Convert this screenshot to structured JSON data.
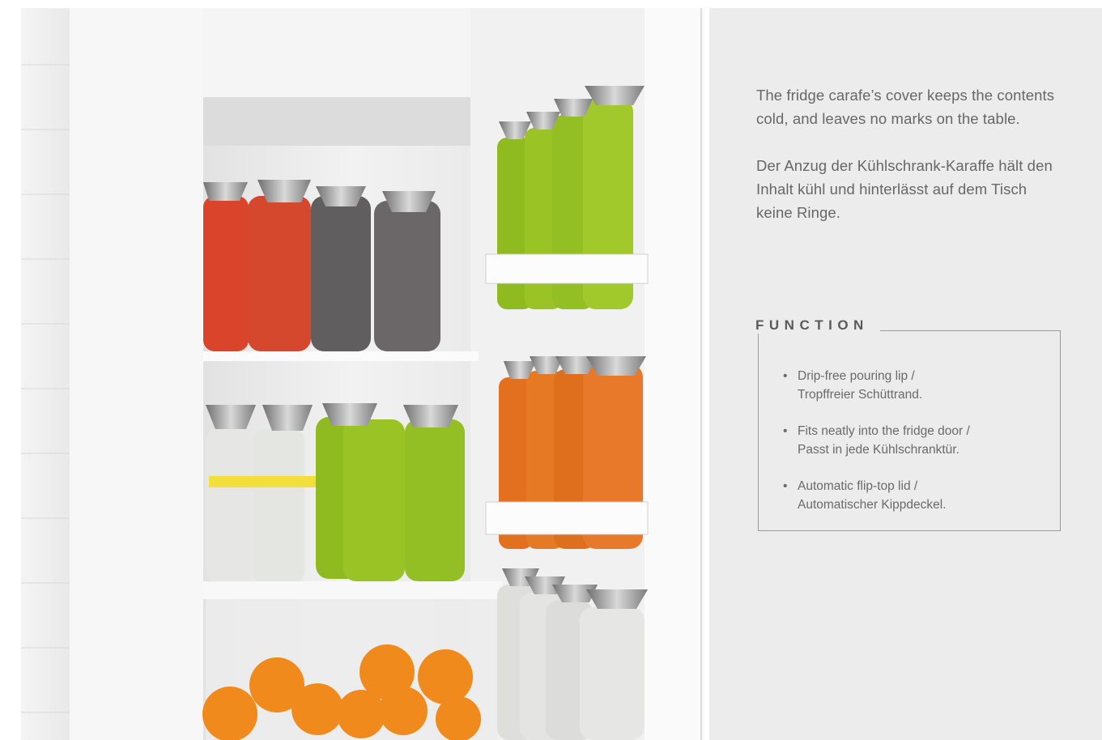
{
  "intro": {
    "english": "The fridge carafe’s cover keeps the contents cold, and leaves no marks on the table.",
    "german": "Der Anzug der Kühlschrank-Karaffe hält den Inhalt kühl und hinterlässt auf dem Tisch keine Ringe."
  },
  "function": {
    "title": "FUNCTION",
    "bullet": "•",
    "items": [
      {
        "line1": "Drip-free pouring lip /",
        "line2": "Tropffreier Schüttrand."
      },
      {
        "line1": "Fits neatly into the fridge door /",
        "line2": "Passt in jede Kühlschranktür."
      },
      {
        "line1": "Automatic flip-top lid /",
        "line2": "Automatischer Kippdeckel."
      }
    ]
  },
  "colors": {
    "panel_bg": "#ececec",
    "text": "#676767",
    "carafe_red": "#d9442a",
    "carafe_grey": "#615e5f",
    "carafe_lime": "#9ac325",
    "carafe_orange": "#e2701f",
    "carafe_white": "#e4e4e2"
  },
  "icons": {
    "photo": "fridge-photo"
  }
}
